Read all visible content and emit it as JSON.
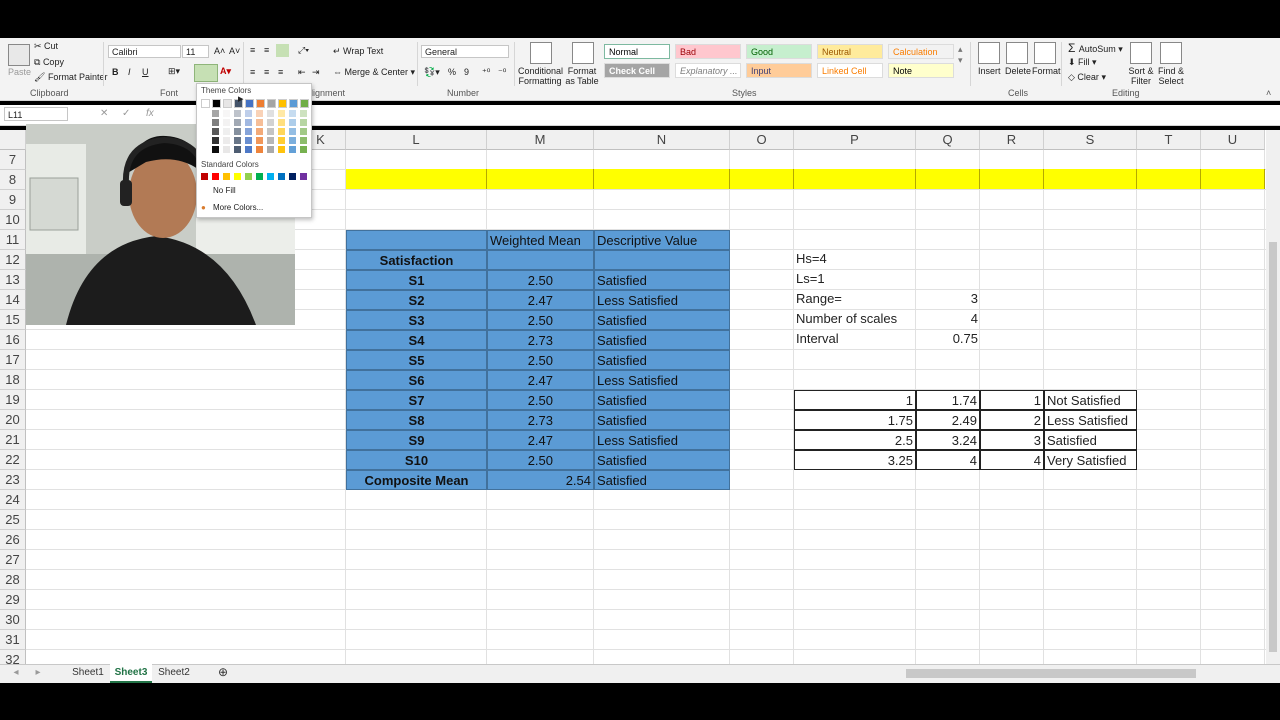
{
  "ribbon": {
    "clipboard": {
      "paste": "Paste",
      "cut": "Cut",
      "copy": "Copy",
      "format_painter": "Format Painter",
      "group": "Clipboard"
    },
    "font": {
      "name": "Calibri",
      "size": "11",
      "group": "Font",
      "bold": "B",
      "italic": "I",
      "underline": "U"
    },
    "alignment": {
      "wrap_text": "Wrap Text",
      "merge_center": "Merge & Center",
      "group": "Alignment",
      "group_visible": "lignment"
    },
    "number": {
      "format": "General",
      "percent": "%",
      "comma": "9",
      "group": "Number"
    },
    "styles": {
      "conditional_formatting": "Conditional Formatting",
      "format_as_table": "Format as Table",
      "cells": [
        {
          "label": "Normal",
          "bg": "#ffffff",
          "color": "#000000"
        },
        {
          "label": "Bad",
          "bg": "#ffc7ce",
          "color": "#9c0006"
        },
        {
          "label": "Good",
          "bg": "#c6efce",
          "color": "#006100"
        },
        {
          "label": "Neutral",
          "bg": "#ffeb9c",
          "color": "#9c5700"
        },
        {
          "label": "Calculation",
          "bg": "#f2f2f2",
          "color": "#fa7d00"
        },
        {
          "label": "Check Cell",
          "bg": "#a5a5a5",
          "color": "#ffffff"
        },
        {
          "label": "Explanatory ...",
          "bg": "#ffffff",
          "color": "#7f7f7f"
        },
        {
          "label": "Input",
          "bg": "#ffcc99",
          "color": "#3f3f76"
        },
        {
          "label": "Linked Cell",
          "bg": "#ffffff",
          "color": "#fa7d00"
        },
        {
          "label": "Note",
          "bg": "#ffffcc",
          "color": "#000000"
        }
      ],
      "group": "Styles"
    },
    "cells": {
      "insert": "Insert",
      "delete": "Delete",
      "format": "Format",
      "group": "Cells"
    },
    "editing": {
      "autosum": "AutoSum",
      "fill": "Fill",
      "clear": "Clear",
      "sort_filter": "Sort & Filter",
      "find_select": "Find & Select",
      "group": "Editing"
    }
  },
  "palette": {
    "theme_title": "Theme Colors",
    "standard_title": "Standard Colors",
    "no_fill": "No Fill",
    "more_colors": "More Colors...",
    "theme_colors": [
      "#ffffff",
      "#000000",
      "#e7e6e6",
      "#44546a",
      "#4472c4",
      "#ed7d31",
      "#a5a5a5",
      "#ffc000",
      "#5b9bd5",
      "#70ad47"
    ],
    "standard_colors": [
      "#c00000",
      "#ff0000",
      "#ffc000",
      "#ffff00",
      "#92d050",
      "#00b050",
      "#00b0f0",
      "#0070c0",
      "#002060",
      "#7030a0"
    ]
  },
  "formula_bar": {
    "name_box": "L11",
    "fx": "fx"
  },
  "columns": [
    "K",
    "L",
    "M",
    "N",
    "O",
    "P",
    "Q",
    "R",
    "S",
    "T",
    "U"
  ],
  "rows": [
    "7",
    "8",
    "9",
    "10",
    "11",
    "12",
    "13",
    "14",
    "15",
    "16",
    "17",
    "18",
    "19",
    "20",
    "21",
    "22",
    "23",
    "24",
    "25",
    "26",
    "27",
    "28",
    "29",
    "30",
    "31",
    "32"
  ],
  "table": {
    "header_mean": "Weighted Mean",
    "header_desc": "Descriptive Value",
    "header_sat": "Satisfaction",
    "rows": [
      {
        "item": "S1",
        "mean": "2.50",
        "desc": "Satisfied"
      },
      {
        "item": "S2",
        "mean": "2.47",
        "desc": "Less Satisfied"
      },
      {
        "item": "S3",
        "mean": "2.50",
        "desc": "Satisfied"
      },
      {
        "item": "S4",
        "mean": "2.73",
        "desc": "Satisfied"
      },
      {
        "item": "S5",
        "mean": "2.50",
        "desc": "Satisfied"
      },
      {
        "item": "S6",
        "mean": "2.47",
        "desc": "Less Satisfied"
      },
      {
        "item": "S7",
        "mean": "2.50",
        "desc": "Satisfied"
      },
      {
        "item": "S8",
        "mean": "2.73",
        "desc": "Satisfied"
      },
      {
        "item": "S9",
        "mean": "2.47",
        "desc": "Less Satisfied"
      },
      {
        "item": "S10",
        "mean": "2.50",
        "desc": "Satisfied"
      }
    ],
    "composite_label": "Composite Mean",
    "composite_mean": "2.54",
    "composite_desc": "Satisfied"
  },
  "params": {
    "hs": "Hs=4",
    "ls": "Ls=1",
    "range_label": "Range=",
    "range_value": "3",
    "scales_label": "Number of scales",
    "scales_value": "4",
    "interval_label": "Interval",
    "interval_value": "0.75"
  },
  "scale_table": [
    {
      "low": "1",
      "high": "1.74",
      "scale": "1",
      "desc": "Not Satisfied"
    },
    {
      "low": "1.75",
      "high": "2.49",
      "scale": "2",
      "desc": "Less Satisfied"
    },
    {
      "low": "2.5",
      "high": "3.24",
      "scale": "3",
      "desc": "Satisfied"
    },
    {
      "low": "3.25",
      "high": "4",
      "scale": "4",
      "desc": "Very Satisfied"
    }
  ],
  "sheets": {
    "tab1": "Sheet1",
    "tab2": "Sheet3",
    "tab3": "Sheet2",
    "active": "Sheet3"
  },
  "colors": {
    "table_blue": "#5b9bd5",
    "highlight_yellow": "#ffff00",
    "active_tab": "#217346"
  }
}
